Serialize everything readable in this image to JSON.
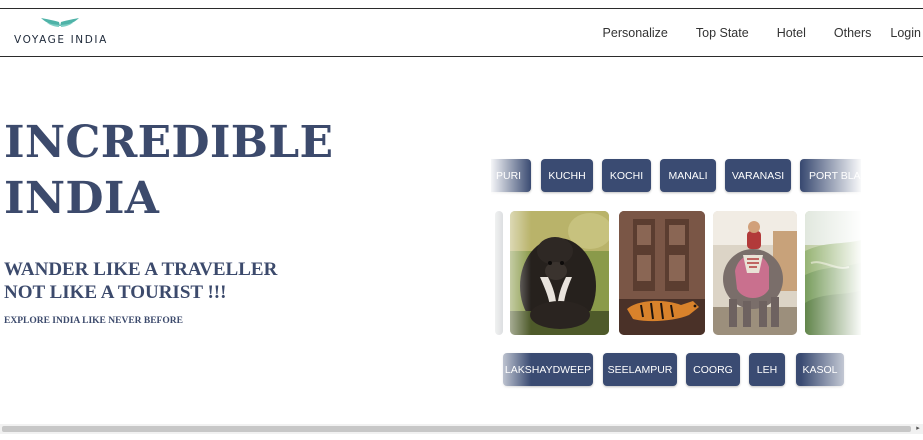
{
  "brand": {
    "name": "VOYAGE INDIA",
    "logo_icon": "wings-icon",
    "logo_color": "#4fb3a8"
  },
  "nav": {
    "links": [
      "Personalize",
      "Top State",
      "Hotel",
      "Others",
      "Login"
    ]
  },
  "hero": {
    "title_line1": "INCREDIBLE",
    "title_line2": "INDIA",
    "tagline_line1": "WANDER LIKE A TRAVELLER",
    "tagline_line2": "NOT LIKE A TOURIST !!!",
    "sub_tagline": "EXPLORE INDIA LIKE NEVER BEFORE",
    "text_color": "#3c4a6c"
  },
  "carousel": {
    "chip_color": "#3a4b72",
    "top_chips": [
      "PURI",
      "KUCHH",
      "KOCHI",
      "MANALI",
      "VARANASI",
      "PORT BLAIR"
    ],
    "bottom_chips": [
      "LAKSHAYDWEEP",
      "SEELAMPUR",
      "COORG",
      "LEH",
      "KASOL"
    ],
    "photos": [
      "monkey-photo",
      "tiger-temple-photo",
      "elephant-photo",
      "hills-photo"
    ]
  }
}
